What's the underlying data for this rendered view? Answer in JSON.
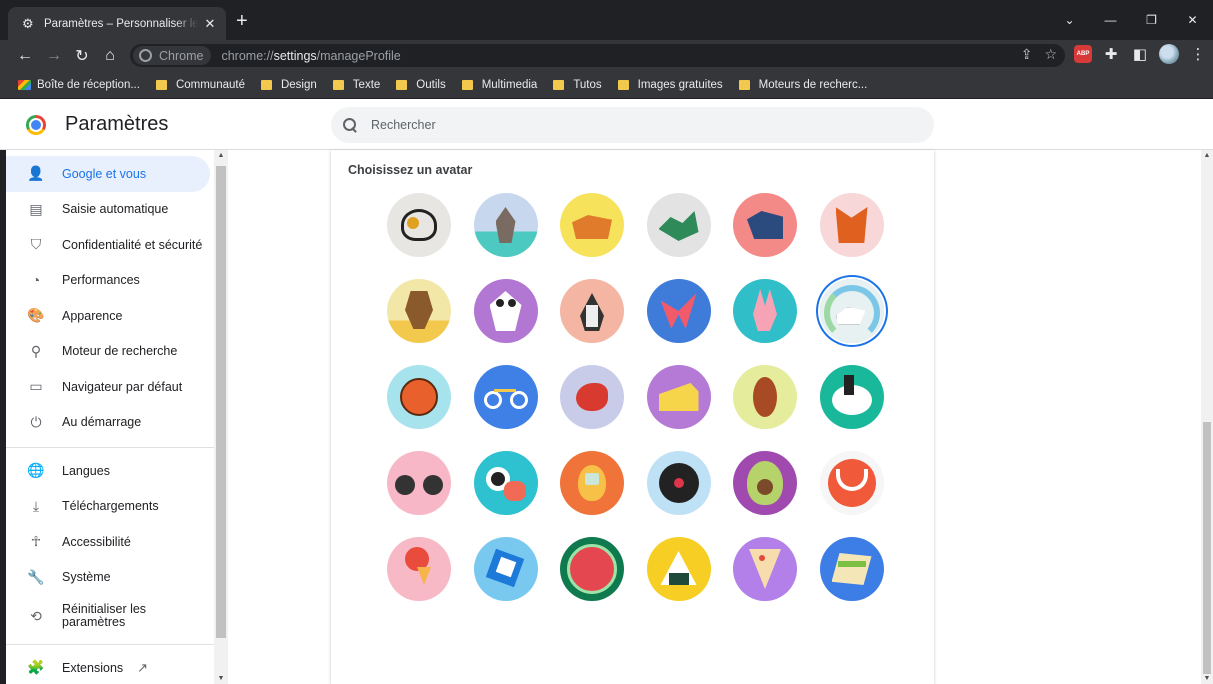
{
  "browser": {
    "tab_title": "Paramètres – Personnaliser le profil",
    "tab_close": "✕",
    "new_tab": "+",
    "chip_label": "Chrome",
    "url_scheme": "chrome://",
    "url_host": "settings",
    "url_path": "/manageProfile",
    "abp_label": "ABP",
    "bookmarks": [
      {
        "label": "Boîte de réception...",
        "icon": "gmail-icon"
      },
      {
        "label": "Communauté",
        "icon": "folder-icon"
      },
      {
        "label": "Design",
        "icon": "folder-icon"
      },
      {
        "label": "Texte",
        "icon": "folder-icon"
      },
      {
        "label": "Outils",
        "icon": "folder-icon"
      },
      {
        "label": "Multimedia",
        "icon": "folder-icon"
      },
      {
        "label": "Tutos",
        "icon": "folder-icon"
      },
      {
        "label": "Images gratuites",
        "icon": "folder-icon"
      },
      {
        "label": "Moteurs de recherc...",
        "icon": "folder-icon"
      }
    ]
  },
  "header": {
    "title": "Paramètres",
    "search_placeholder": "Rechercher"
  },
  "sidebar": {
    "items": [
      {
        "label": "Google et vous",
        "icon": "person-icon",
        "active": true
      },
      {
        "label": "Saisie automatique",
        "icon": "clipboard-icon"
      },
      {
        "label": "Confidentialité et sécurité",
        "icon": "shield-icon"
      },
      {
        "label": "Performances",
        "icon": "gauge-icon"
      },
      {
        "label": "Apparence",
        "icon": "palette-icon"
      },
      {
        "label": "Moteur de recherche",
        "icon": "search-icon"
      },
      {
        "label": "Navigateur par défaut",
        "icon": "browser-window-icon"
      },
      {
        "label": "Au démarrage",
        "icon": "power-icon"
      },
      {
        "label": "Langues",
        "icon": "globe-icon"
      },
      {
        "label": "Téléchargements",
        "icon": "download-icon"
      },
      {
        "label": "Accessibilité",
        "icon": "accessibility-icon"
      },
      {
        "label": "Système",
        "icon": "wrench-icon"
      },
      {
        "label": "Réinitialiser les paramètres",
        "icon": "reset-icon"
      },
      {
        "label": "Extensions",
        "icon": "puzzle-icon"
      }
    ]
  },
  "card": {
    "title": "Choisissez un avatar",
    "selected_avatar": "rainbow-unicorn"
  },
  "avatars": [
    "origami-sun-moon-heart",
    "origami-cat",
    "origami-corgi",
    "origami-dragon",
    "origami-elephant",
    "origami-fox",
    "origami-monkey",
    "origami-panda",
    "origami-penguin",
    "origami-butterfly",
    "origami-rabbit",
    "rainbow-unicorn",
    "basketball",
    "bicycle",
    "red-bird",
    "cheese",
    "football",
    "sushi-plate",
    "sunglasses",
    "sushi-roll",
    "tamagotchi",
    "vinyl-record",
    "avocado",
    "smile",
    "ice-cream",
    "cube",
    "watermelon",
    "onigiri",
    "pizza",
    "sandwich"
  ],
  "colors": {
    "accent": "#1a73e8",
    "active_bg": "#e8f0fe",
    "browser_dark": "#202124",
    "toolbar": "#35363a"
  }
}
